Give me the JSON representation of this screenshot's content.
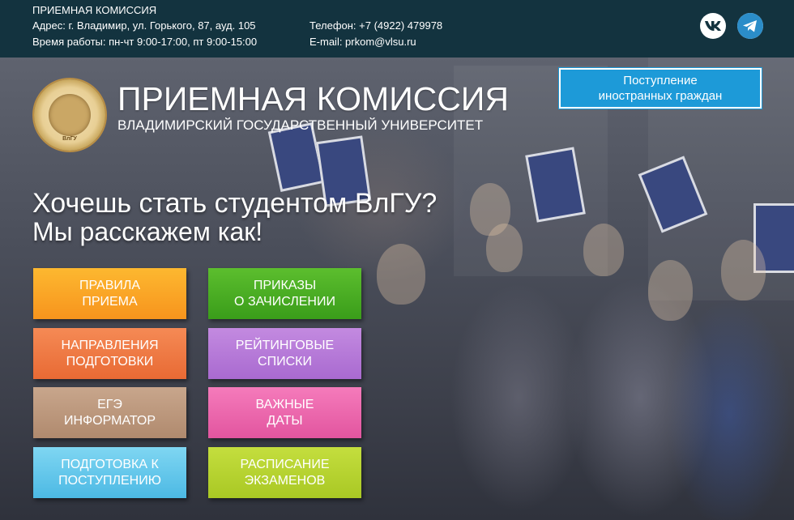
{
  "header": {
    "org_title": "ПРИЕМНАЯ КОМИССИЯ",
    "address": "Адрес: г. Владимир, ул. Горького, 87, ауд. 105",
    "hours": "Время работы: пн-чт 9:00-17:00, пт 9:00-15:00",
    "phone": "Телефон: +7 (4922) 479978",
    "email": "E-mail: prkom@vlsu.ru",
    "social": [
      {
        "icon": "vk-icon",
        "color": "#13333f"
      },
      {
        "icon": "telegram-icon",
        "color": "#2b8dc9"
      }
    ]
  },
  "brand": {
    "emblem_text": "ВлГУ",
    "title": "ПРИЕМНАЯ КОМИССИЯ",
    "subtitle": "ВЛАДИМИРСКИЙ ГОСУДАРСТВЕННЫЙ УНИВЕРСИТЕТ"
  },
  "foreign_button": {
    "label": "Поступление\nиностранных граждан",
    "color": "#1d9ad8"
  },
  "hero": {
    "headline": "Хочешь стать студентом ВлГУ?",
    "subheadline": "Мы расскажем как!"
  },
  "tiles": [
    {
      "id": "rules",
      "label": "ПРАВИЛА\nПРИЕМА",
      "color_top": "#fdb830",
      "color_bottom": "#f7941d"
    },
    {
      "id": "orders",
      "label": "ПРИКАЗЫ\nО ЗАЧИСЛЕНИИ",
      "color_top": "#5cbe2e",
      "color_bottom": "#3a9d1a"
    },
    {
      "id": "directions",
      "label": "НАПРАВЛЕНИЯ\nПОДГОТОВКИ",
      "color_top": "#f58a55",
      "color_bottom": "#e86a34"
    },
    {
      "id": "ratings",
      "label": "РЕЙТИНГОВЫЕ\nСПИСКИ",
      "color_top": "#c38ae0",
      "color_bottom": "#a96ad0"
    },
    {
      "id": "ege",
      "label": "ЕГЭ\nИНФОРМАТОР",
      "color_top": "#c8a68c",
      "color_bottom": "#b08a6e"
    },
    {
      "id": "dates",
      "label": "ВАЖНЫЕ\nДАТЫ",
      "color_top": "#f57bbb",
      "color_bottom": "#e2559f"
    },
    {
      "id": "prep",
      "label": "ПОДГОТОВКА К\nПОСТУПЛЕНИЮ",
      "color_top": "#7fd6f2",
      "color_bottom": "#4cb9e4"
    },
    {
      "id": "exams",
      "label": "РАСПИСАНИЕ\nЭКЗАМЕНОВ",
      "color_top": "#c4de3e",
      "color_bottom": "#a9c824"
    }
  ]
}
